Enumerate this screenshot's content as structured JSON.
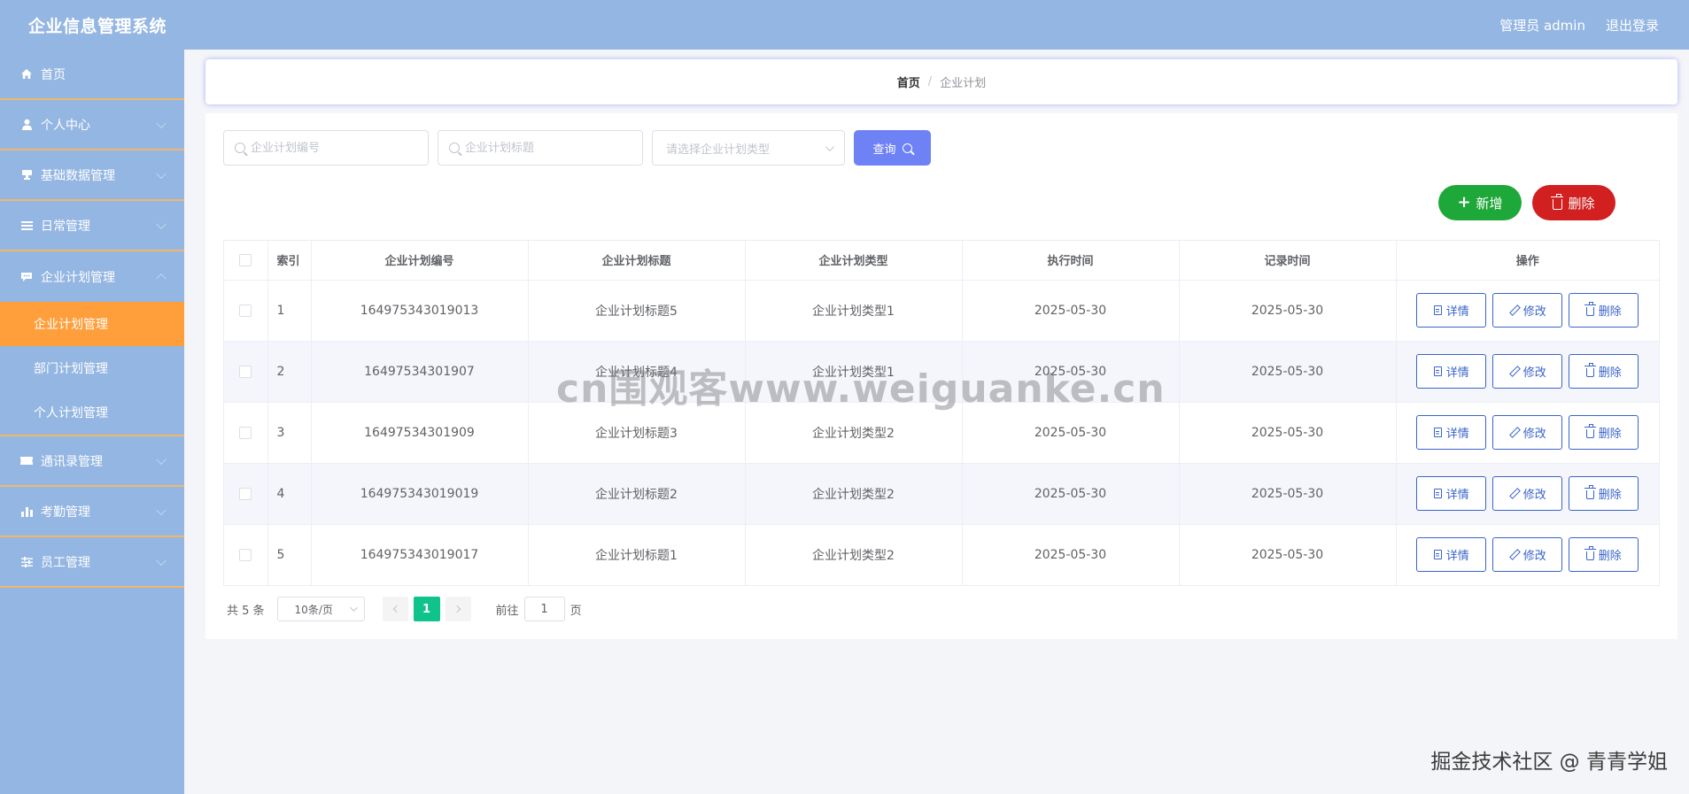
{
  "header": {
    "title": "企业信息管理系统",
    "user": "管理员 admin",
    "logout": "退出登录"
  },
  "sidebar": {
    "items": [
      {
        "label": "首页",
        "icon": "home-icon"
      },
      {
        "label": "个人中心",
        "icon": "user-icon"
      },
      {
        "label": "基础数据管理",
        "icon": "trophy-icon"
      },
      {
        "label": "日常管理",
        "icon": "list-icon"
      },
      {
        "label": "企业计划管理",
        "icon": "chat-icon"
      },
      {
        "label": "通讯录管理",
        "icon": "ticket-icon"
      },
      {
        "label": "考勤管理",
        "icon": "bar-chart-icon"
      },
      {
        "label": "员工管理",
        "icon": "sliders-icon"
      }
    ],
    "subitems": [
      {
        "label": "企业计划管理",
        "active": true
      },
      {
        "label": "部门计划管理",
        "active": false
      },
      {
        "label": "个人计划管理",
        "active": false
      }
    ]
  },
  "breadcrumb": {
    "home": "首页",
    "separator": "/",
    "current": "企业计划"
  },
  "search": {
    "code_placeholder": "企业计划编号",
    "title_placeholder": "企业计划标题",
    "type_placeholder": "请选择企业计划类型",
    "query_label": "查询"
  },
  "actions": {
    "add_label": "新增",
    "delete_label": "删除"
  },
  "table": {
    "headers": [
      "索引",
      "企业计划编号",
      "企业计划标题",
      "企业计划类型",
      "执行时间",
      "记录时间",
      "操作"
    ],
    "rows": [
      {
        "index": "1",
        "code": "164975343019013",
        "title": "企业计划标题5",
        "type": "企业计划类型1",
        "exec_time": "2025-05-30",
        "record_time": "2025-05-30"
      },
      {
        "index": "2",
        "code": "16497534301907",
        "title": "企业计划标题4",
        "type": "企业计划类型1",
        "exec_time": "2025-05-30",
        "record_time": "2025-05-30"
      },
      {
        "index": "3",
        "code": "16497534301909",
        "title": "企业计划标题3",
        "type": "企业计划类型2",
        "exec_time": "2025-05-30",
        "record_time": "2025-05-30"
      },
      {
        "index": "4",
        "code": "164975343019019",
        "title": "企业计划标题2",
        "type": "企业计划类型2",
        "exec_time": "2025-05-30",
        "record_time": "2025-05-30"
      },
      {
        "index": "5",
        "code": "164975343019017",
        "title": "企业计划标题1",
        "type": "企业计划类型2",
        "exec_time": "2025-05-30",
        "record_time": "2025-05-30"
      }
    ],
    "row_actions": {
      "detail": "详情",
      "edit": "修改",
      "delete": "删除"
    }
  },
  "pagination": {
    "total": "共 5 条",
    "page_size": "10条/页",
    "current_page": "1",
    "goto_prefix": "前往",
    "goto_value": "1",
    "goto_suffix": "页"
  },
  "watermarks": {
    "center": "cn围观客www.weiguanke.cn",
    "corner": "掘金技术社区 @ 青青学姐"
  },
  "colors": {
    "header_bg": "#94b6e2",
    "sidebar_active": "#ff9f3b",
    "query_btn": "#6e82f5",
    "add_btn": "#1fa83a",
    "delete_btn": "#d21f1f",
    "page_active": "#10c38a",
    "op_border": "#3a64c9"
  }
}
